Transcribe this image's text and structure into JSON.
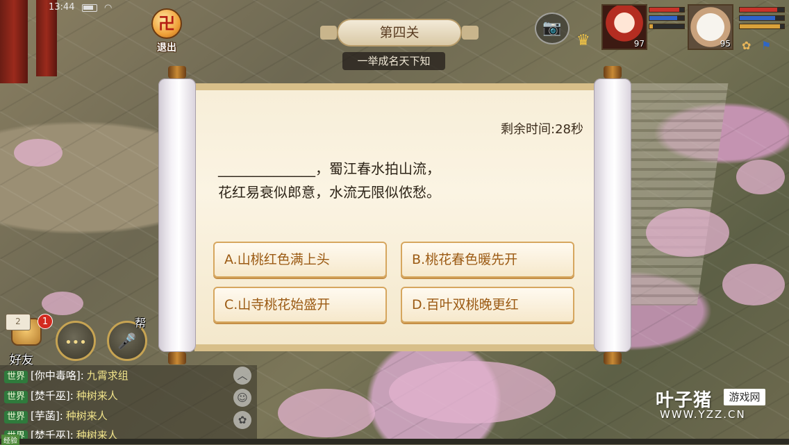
{
  "status_bar": {
    "time": "13:44"
  },
  "hud": {
    "exit_label": "退出",
    "exit_glyph": "卍",
    "level_title": "第四关",
    "level_subtitle": "一举成名天下知",
    "camera_glyph": "📷",
    "rank_glyph": "♛",
    "hero_level": "97",
    "pet_level": "95",
    "bag_glyph": "✿",
    "flag_glyph": "⚑"
  },
  "bars": {
    "hero_hp": 0.85,
    "hero_mp": 0.8,
    "hero_ex": 0.1,
    "pet_hp": 0.85,
    "pet_mp": 0.8,
    "pet_ex": 0.9
  },
  "colors": {
    "hp": "#c8332a",
    "mp": "#2f63c9",
    "ex": "#d9a13a"
  },
  "quiz": {
    "timer_text": "剩余时间:28秒",
    "question_line1": "______________，蜀江春水拍山流，",
    "question_line2": "花红易衰似郎意，水流无限似侬愁。",
    "options": [
      {
        "label": "A.山桃红色满上头"
      },
      {
        "label": "B.桃花春色暖先开"
      },
      {
        "label": "C.山寺桃花始盛开"
      },
      {
        "label": "D.百叶双桃晚更红"
      }
    ]
  },
  "social": {
    "mail_count": "2",
    "badge_count": "1",
    "friends_label": "好友",
    "chat_glyph": "•••",
    "voice_glyph": "🎤",
    "help_label": "帮"
  },
  "chat": [
    {
      "channel": "世界",
      "name": "[你中毒咯]:",
      "message": "九霄求组"
    },
    {
      "channel": "世界",
      "name": "[焚千巫]:",
      "message": "种树来人"
    },
    {
      "channel": "世界",
      "name": "[芋菡]:",
      "message": "种树来人"
    },
    {
      "channel": "世界",
      "name": "[焚千巫]:",
      "message": "种树来人"
    }
  ],
  "chat_controls": {
    "up_glyph": "︿",
    "emoji_glyph": "☺",
    "settings_glyph": "✿"
  },
  "exp_label": "经验",
  "watermark": {
    "main": "叶子猪",
    "box": "游戏网",
    "url": "WWW.YZZ.CN"
  }
}
